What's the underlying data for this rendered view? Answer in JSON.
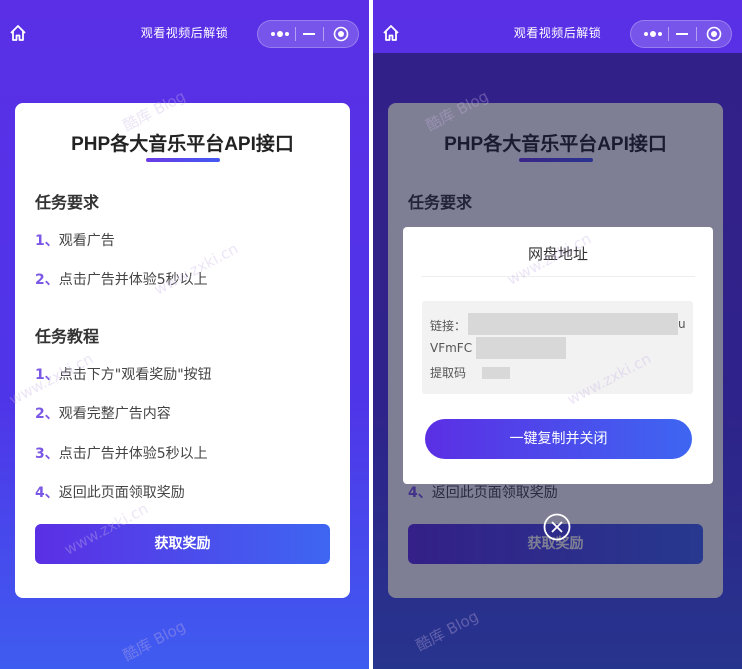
{
  "nav": {
    "title": "观看视频后解锁"
  },
  "card": {
    "title": "PHP各大音乐平台API接口",
    "requirements_heading": "任务要求",
    "requirements": [
      {
        "num": "1",
        "text": "观看广告"
      },
      {
        "num": "2",
        "text": "点击广告并体验5秒以上"
      }
    ],
    "tutorial_heading": "任务教程",
    "tutorial": [
      {
        "num": "1",
        "text": "点击下方\"观看奖励\"按钮"
      },
      {
        "num": "2",
        "text": "观看完整广告内容"
      },
      {
        "num": "3",
        "text": "点击广告并体验5秒以上"
      },
      {
        "num": "4",
        "text": "返回此页面领取奖励"
      }
    ],
    "button_label": "获取奖励"
  },
  "modal": {
    "title": "网盘地址",
    "link_label": "链接：",
    "link_tail": "u",
    "line2": "VFmFC",
    "code_label": "提取码",
    "copy_button": "一键复制并关闭"
  },
  "watermark": {
    "brand": "酷库 Blog",
    "url": "www.zxki.cn"
  },
  "colors": {
    "accent_start": "#5b2fe4",
    "accent_end": "#3e66f2",
    "number": "#7b57e6"
  }
}
